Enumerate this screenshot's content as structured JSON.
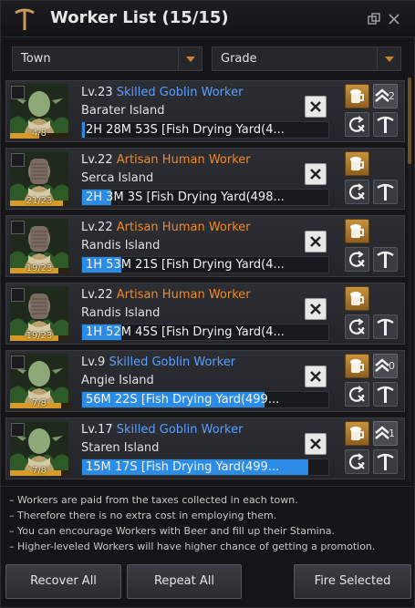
{
  "window": {
    "title": "Worker List (15/15)",
    "icons": {
      "title": "pickaxe-icon",
      "popout": "popout-icon",
      "close": "close-icon"
    }
  },
  "filters": {
    "town": "Town",
    "grade": "Grade"
  },
  "workers": [
    {
      "level": "Lv.23",
      "grade": "Skilled Goblin Worker",
      "grade_color": "#5aa0ff",
      "race": "goblin",
      "stamina": "4/8",
      "stamina_fraction": 0.5,
      "island": "Barater Island",
      "task": "2H 28M 53S [Fish Drying Yard(4...",
      "progress": 0.01,
      "promotion": "2"
    },
    {
      "level": "Lv.22",
      "grade": "Artisan Human Worker",
      "grade_color": "#f08a24",
      "race": "human",
      "stamina": "21/23",
      "stamina_fraction": 0.91,
      "island": "Serca Island",
      "task": "2H 3M 3S [Fish Drying Yard(498...",
      "progress": 0.12,
      "promotion": ""
    },
    {
      "level": "Lv.22",
      "grade": "Artisan Human Worker",
      "grade_color": "#f08a24",
      "race": "human",
      "stamina": "19/23",
      "stamina_fraction": 0.83,
      "island": "Randis Island",
      "task": "1H 53M 21S [Fish Drying Yard(4...",
      "progress": 0.16,
      "promotion": ""
    },
    {
      "level": "Lv.22",
      "grade": "Artisan Human Worker",
      "grade_color": "#f08a24",
      "race": "human",
      "stamina": "19/23",
      "stamina_fraction": 0.83,
      "island": "Randis Island",
      "task": "1H 52M 45S [Fish Drying Yard(4...",
      "progress": 0.16,
      "promotion": ""
    },
    {
      "level": "Lv.9",
      "grade": "Skilled Goblin Worker",
      "grade_color": "#5aa0ff",
      "race": "goblin",
      "stamina": "7/8",
      "stamina_fraction": 0.88,
      "island": "Angie Island",
      "task": "56M 22S [Fish Drying Yard(499...",
      "progress": 0.74,
      "promotion": "0"
    },
    {
      "level": "Lv.17",
      "grade": "Skilled Goblin Worker",
      "grade_color": "#5aa0ff",
      "race": "goblin",
      "stamina": "7/8",
      "stamina_fraction": 0.88,
      "island": "Staren Island",
      "task": "15M 17S [Fish Drying Yard(499...",
      "progress": 0.92,
      "promotion": "1"
    }
  ],
  "notes": [
    "– Workers are paid from the taxes collected in each town.",
    "– Therefore there is no extra cost in employing them.",
    "– You can encourage Workers with Beer and fill up their Stamina.",
    "– Higher-leveled Workers will have higher chance of getting a promotion."
  ],
  "buttons": {
    "recover_all": "Recover All",
    "repeat_all": "Repeat All",
    "fire_selected": "Fire Selected"
  },
  "colors": {
    "accent": "#c9822e",
    "progress": "#2b8ce6",
    "skilled": "#5aa0ff",
    "artisan": "#f08a24"
  }
}
